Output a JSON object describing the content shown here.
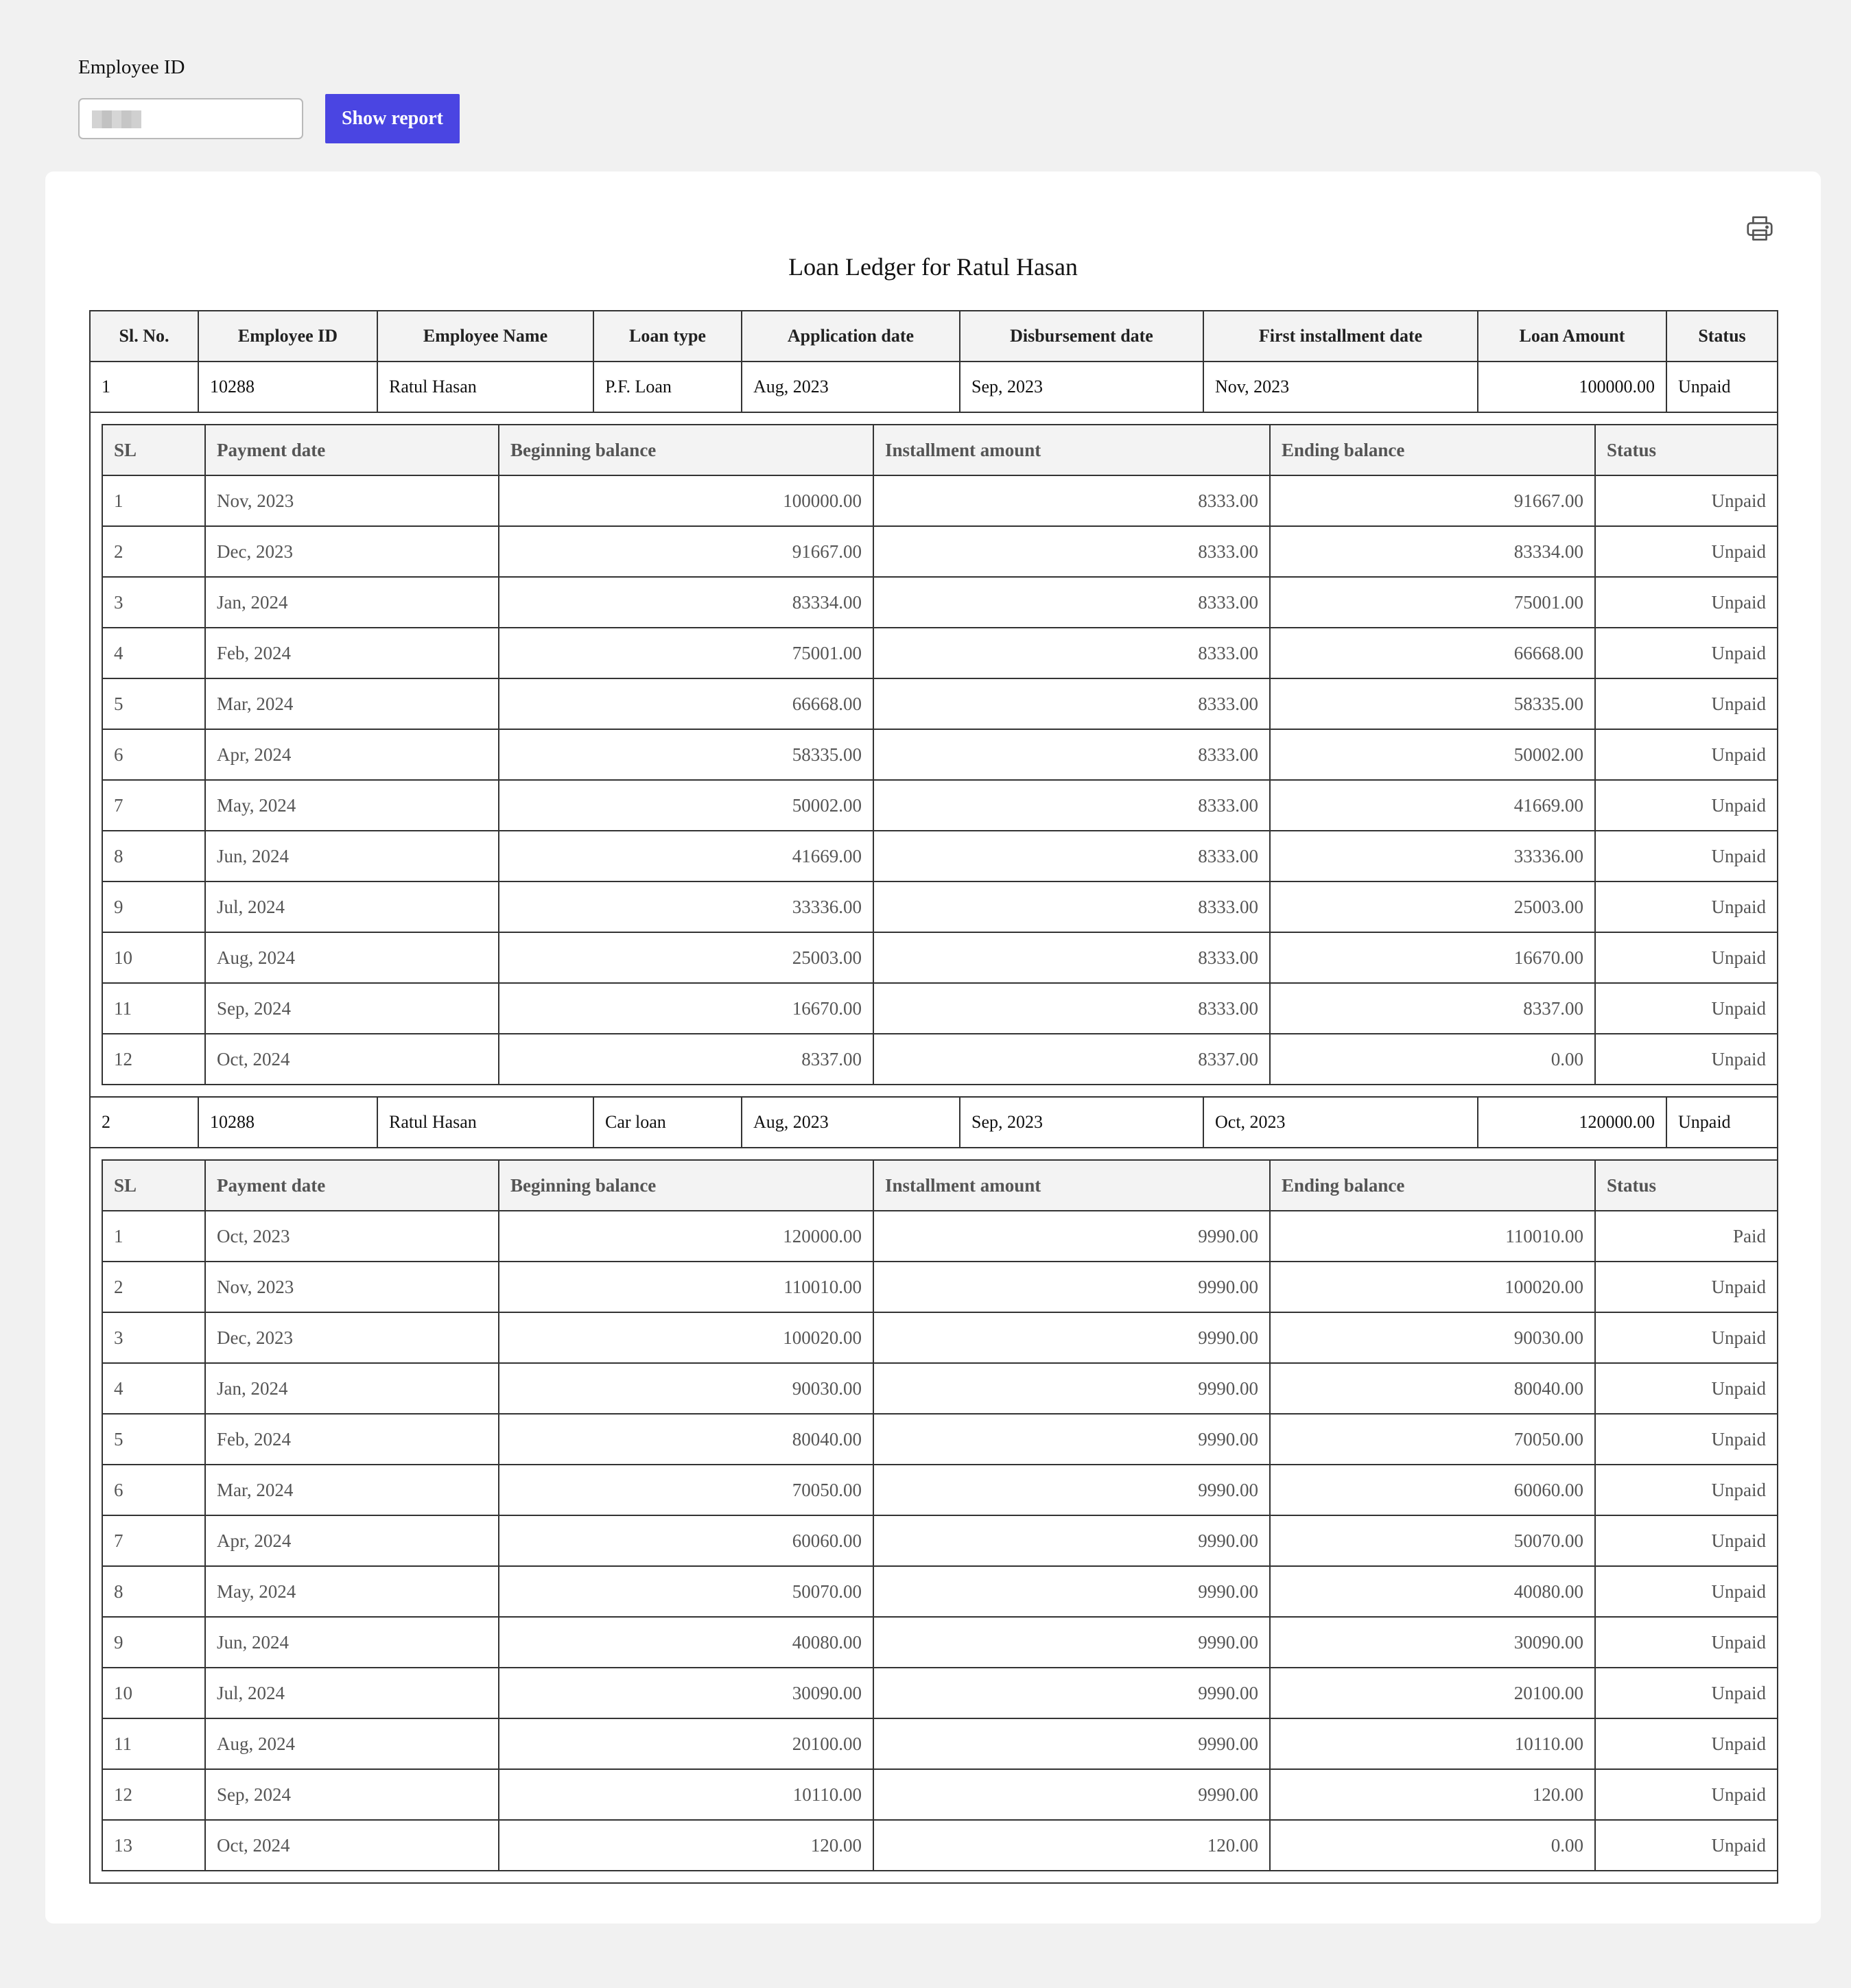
{
  "filter": {
    "label": "Employee ID",
    "button_label": "Show report"
  },
  "report": {
    "title": "Loan Ledger for Ratul Hasan",
    "print_icon": "printer-icon",
    "columns": [
      "Sl. No.",
      "Employee ID",
      "Employee Name",
      "Loan type",
      "Application date",
      "Disbursement date",
      "First installment date",
      "Loan Amount",
      "Status"
    ],
    "schedule_columns": [
      "SL",
      "Payment date",
      "Beginning balance",
      "Installment amount",
      "Ending balance",
      "Status"
    ],
    "loans": [
      {
        "sl": "1",
        "employee_id": "10288",
        "employee_name": "Ratul Hasan",
        "loan_type": "P.F. Loan",
        "application_date": "Aug, 2023",
        "disbursement_date": "Sep, 2023",
        "first_installment_date": "Nov, 2023",
        "loan_amount": "100000.00",
        "status": "Unpaid",
        "schedule": [
          [
            "1",
            "Nov, 2023",
            "100000.00",
            "8333.00",
            "91667.00",
            "Unpaid"
          ],
          [
            "2",
            "Dec, 2023",
            "91667.00",
            "8333.00",
            "83334.00",
            "Unpaid"
          ],
          [
            "3",
            "Jan, 2024",
            "83334.00",
            "8333.00",
            "75001.00",
            "Unpaid"
          ],
          [
            "4",
            "Feb, 2024",
            "75001.00",
            "8333.00",
            "66668.00",
            "Unpaid"
          ],
          [
            "5",
            "Mar, 2024",
            "66668.00",
            "8333.00",
            "58335.00",
            "Unpaid"
          ],
          [
            "6",
            "Apr, 2024",
            "58335.00",
            "8333.00",
            "50002.00",
            "Unpaid"
          ],
          [
            "7",
            "May, 2024",
            "50002.00",
            "8333.00",
            "41669.00",
            "Unpaid"
          ],
          [
            "8",
            "Jun, 2024",
            "41669.00",
            "8333.00",
            "33336.00",
            "Unpaid"
          ],
          [
            "9",
            "Jul, 2024",
            "33336.00",
            "8333.00",
            "25003.00",
            "Unpaid"
          ],
          [
            "10",
            "Aug, 2024",
            "25003.00",
            "8333.00",
            "16670.00",
            "Unpaid"
          ],
          [
            "11",
            "Sep, 2024",
            "16670.00",
            "8333.00",
            "8337.00",
            "Unpaid"
          ],
          [
            "12",
            "Oct, 2024",
            "8337.00",
            "8337.00",
            "0.00",
            "Unpaid"
          ]
        ]
      },
      {
        "sl": "2",
        "employee_id": "10288",
        "employee_name": "Ratul Hasan",
        "loan_type": "Car loan",
        "application_date": "Aug, 2023",
        "disbursement_date": "Sep, 2023",
        "first_installment_date": "Oct, 2023",
        "loan_amount": "120000.00",
        "status": "Unpaid",
        "schedule": [
          [
            "1",
            "Oct, 2023",
            "120000.00",
            "9990.00",
            "110010.00",
            "Paid"
          ],
          [
            "2",
            "Nov, 2023",
            "110010.00",
            "9990.00",
            "100020.00",
            "Unpaid"
          ],
          [
            "3",
            "Dec, 2023",
            "100020.00",
            "9990.00",
            "90030.00",
            "Unpaid"
          ],
          [
            "4",
            "Jan, 2024",
            "90030.00",
            "9990.00",
            "80040.00",
            "Unpaid"
          ],
          [
            "5",
            "Feb, 2024",
            "80040.00",
            "9990.00",
            "70050.00",
            "Unpaid"
          ],
          [
            "6",
            "Mar, 2024",
            "70050.00",
            "9990.00",
            "60060.00",
            "Unpaid"
          ],
          [
            "7",
            "Apr, 2024",
            "60060.00",
            "9990.00",
            "50070.00",
            "Unpaid"
          ],
          [
            "8",
            "May, 2024",
            "50070.00",
            "9990.00",
            "40080.00",
            "Unpaid"
          ],
          [
            "9",
            "Jun, 2024",
            "40080.00",
            "9990.00",
            "30090.00",
            "Unpaid"
          ],
          [
            "10",
            "Jul, 2024",
            "30090.00",
            "9990.00",
            "20100.00",
            "Unpaid"
          ],
          [
            "11",
            "Aug, 2024",
            "20100.00",
            "9990.00",
            "10110.00",
            "Unpaid"
          ],
          [
            "12",
            "Sep, 2024",
            "10110.00",
            "9990.00",
            "120.00",
            "Unpaid"
          ],
          [
            "13",
            "Oct, 2024",
            "120.00",
            "120.00",
            "0.00",
            "Unpaid"
          ]
        ]
      }
    ]
  }
}
